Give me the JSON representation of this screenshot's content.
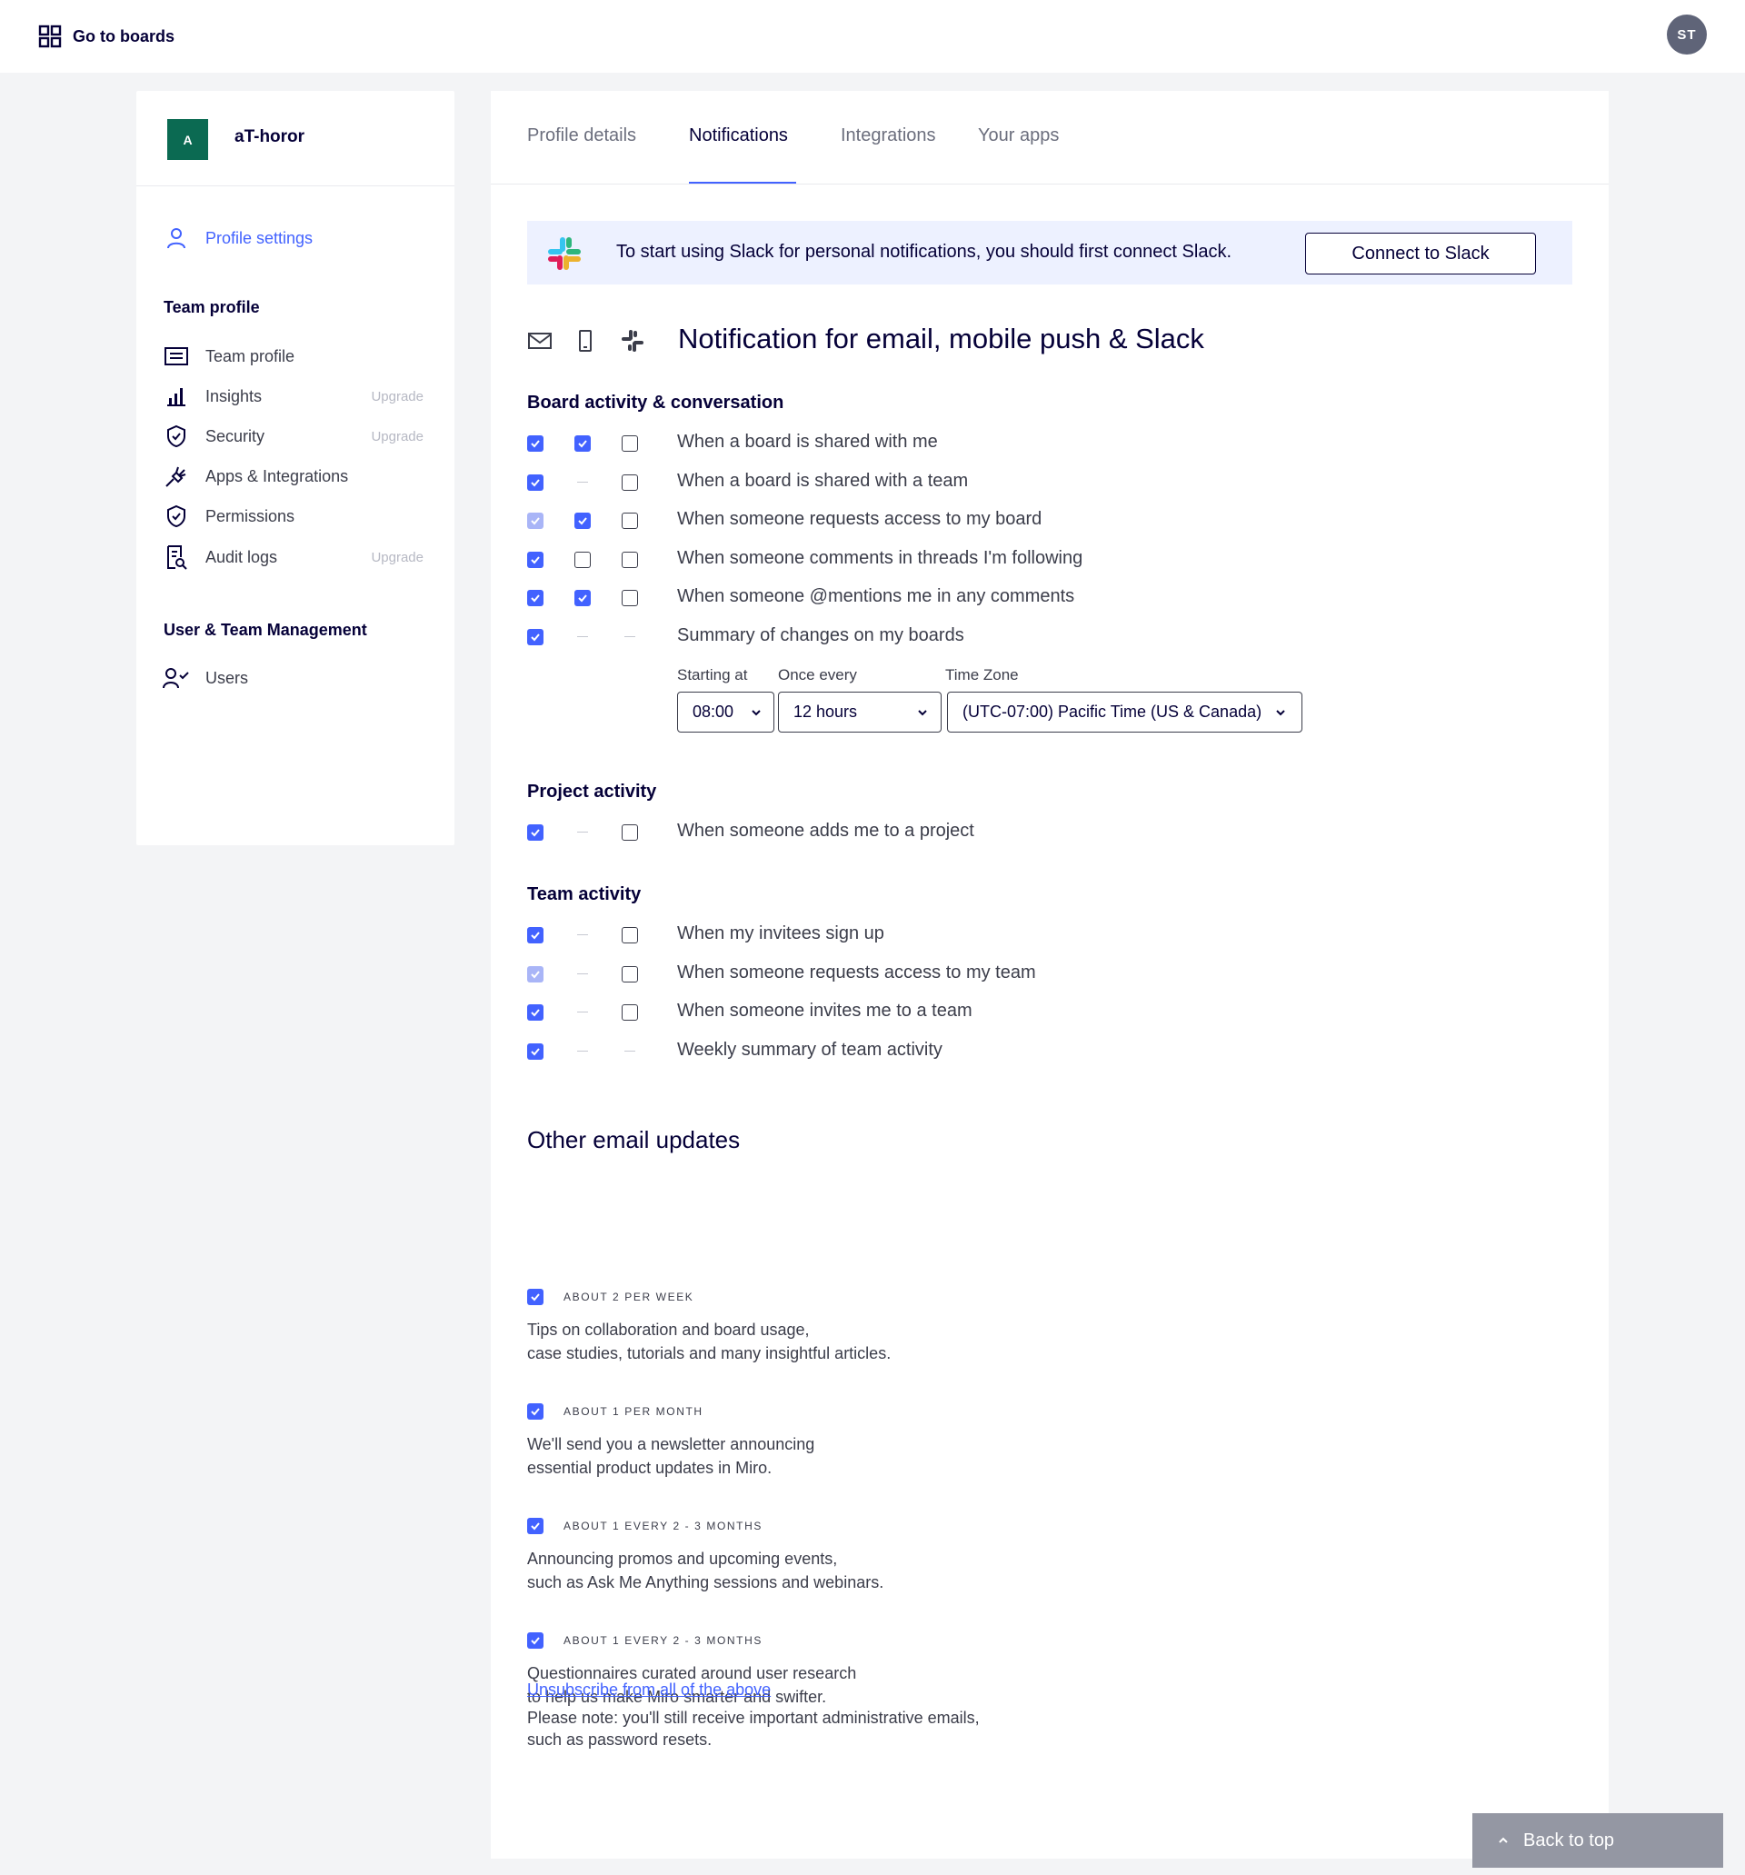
{
  "topbar": {
    "goto_label": "Go to boards",
    "avatar_initials": "ST"
  },
  "sidebar": {
    "team_logo": "A",
    "team_name": "aT-horor",
    "profile_settings": "Profile settings",
    "team_profile_section": "Team profile",
    "items": [
      {
        "label": "Team profile",
        "upgrade": ""
      },
      {
        "label": "Insights",
        "upgrade": "Upgrade"
      },
      {
        "label": "Security",
        "upgrade": "Upgrade"
      },
      {
        "label": "Apps & Integrations",
        "upgrade": ""
      },
      {
        "label": "Permissions",
        "upgrade": ""
      },
      {
        "label": "Audit logs",
        "upgrade": "Upgrade"
      }
    ],
    "management_section": "User & Team Management",
    "users": "Users"
  },
  "tabs": [
    "Profile details",
    "Notifications",
    "Integrations",
    "Your apps"
  ],
  "slack": {
    "banner_text": "To start using Slack for personal notifications, you should first connect Slack.",
    "button": "Connect to Slack"
  },
  "notif_title": "Notification for email, mobile push & Slack",
  "board_section": {
    "title": "Board activity & conversation",
    "rows": [
      {
        "label": "When a board is shared with me",
        "email": "on",
        "mobile": "on",
        "slack": "off"
      },
      {
        "label": "When a board is shared with a team",
        "email": "on",
        "mobile": "none",
        "slack": "off"
      },
      {
        "label": "When someone requests access to my board",
        "email": "dim",
        "mobile": "on",
        "slack": "off"
      },
      {
        "label": "When someone comments in threads I'm following",
        "email": "on",
        "mobile": "off",
        "slack": "off"
      },
      {
        "label": "When someone @mentions me in any comments",
        "email": "on",
        "mobile": "on",
        "slack": "off"
      },
      {
        "label": "Summary of changes on my boards",
        "email": "on",
        "mobile": "none",
        "slack": "none"
      }
    ],
    "starting_label": "Starting at",
    "starting_value": "08:00",
    "every_label": "Once every",
    "every_value": "12 hours",
    "tz_label": "Time Zone",
    "tz_value": "(UTC-07:00) Pacific Time (US & Canada)"
  },
  "project_section": {
    "title": "Project activity",
    "rows": [
      {
        "label": "When someone adds me to a project",
        "email": "on",
        "mobile": "none",
        "slack": "off"
      }
    ]
  },
  "team_section": {
    "title": "Team activity",
    "rows": [
      {
        "label": "When my invitees sign up",
        "email": "on",
        "mobile": "none",
        "slack": "off"
      },
      {
        "label": "When someone requests access to my team",
        "email": "dim",
        "mobile": "none",
        "slack": "off"
      },
      {
        "label": "When someone invites me to a team",
        "email": "on",
        "mobile": "none",
        "slack": "off"
      },
      {
        "label": "Weekly summary of team activity",
        "email": "on",
        "mobile": "none",
        "slack": "none"
      }
    ]
  },
  "other": {
    "title": "Other email updates",
    "items": [
      {
        "freq": "ABOUT 2 PER WEEK",
        "line1": "Tips on collaboration and board usage,",
        "line2": "case studies, tutorials and many insightful articles."
      },
      {
        "freq": "ABOUT 1 PER MONTH",
        "line1": "We'll send you a newsletter announcing",
        "line2": "essential product updates in Miro."
      },
      {
        "freq": "ABOUT 1 EVERY 2 - 3 MONTHS",
        "line1": "Announcing promos and upcoming events,",
        "line2": "such as Ask Me Anything sessions and webinars."
      },
      {
        "freq": "ABOUT 1 EVERY 2 - 3 MONTHS",
        "line1": "Questionnaires curated around user research",
        "line2": "to help us make Miro smarter and swifter."
      }
    ],
    "unsubscribe": "Unsubscribe from all of the above",
    "note_line1": "Please note: you'll still receive important administrative emails,",
    "note_line2": "such as password resets."
  },
  "back_to_top": "Back to top",
  "colors": {
    "accent": "#4262ff",
    "team_logo": "#0b6a52",
    "text": "#050038"
  }
}
